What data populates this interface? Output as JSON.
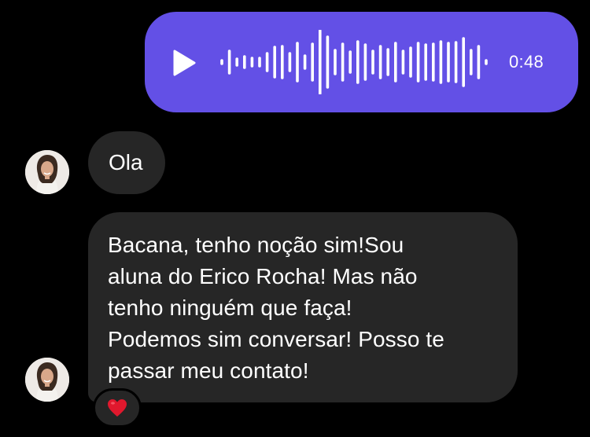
{
  "voice_message": {
    "duration": "0:48",
    "play_icon": "play-icon",
    "color": "#6350e6"
  },
  "messages": [
    {
      "sender_avatar": "avatar",
      "text": "Ola"
    },
    {
      "sender_avatar": "avatar",
      "lines": [
        "Bacana, tenho noção sim!Sou",
        "aluna do Erico Rocha! Mas não",
        "tenho ninguém que faça!",
        "Podemos sim conversar! Posso te",
        "passar meu contato!"
      ],
      "reaction": "heart-icon"
    }
  ],
  "colors": {
    "background": "#000000",
    "received_bubble": "#262626",
    "sent_bubble": "#6350e6",
    "heart": "#e0182d"
  }
}
